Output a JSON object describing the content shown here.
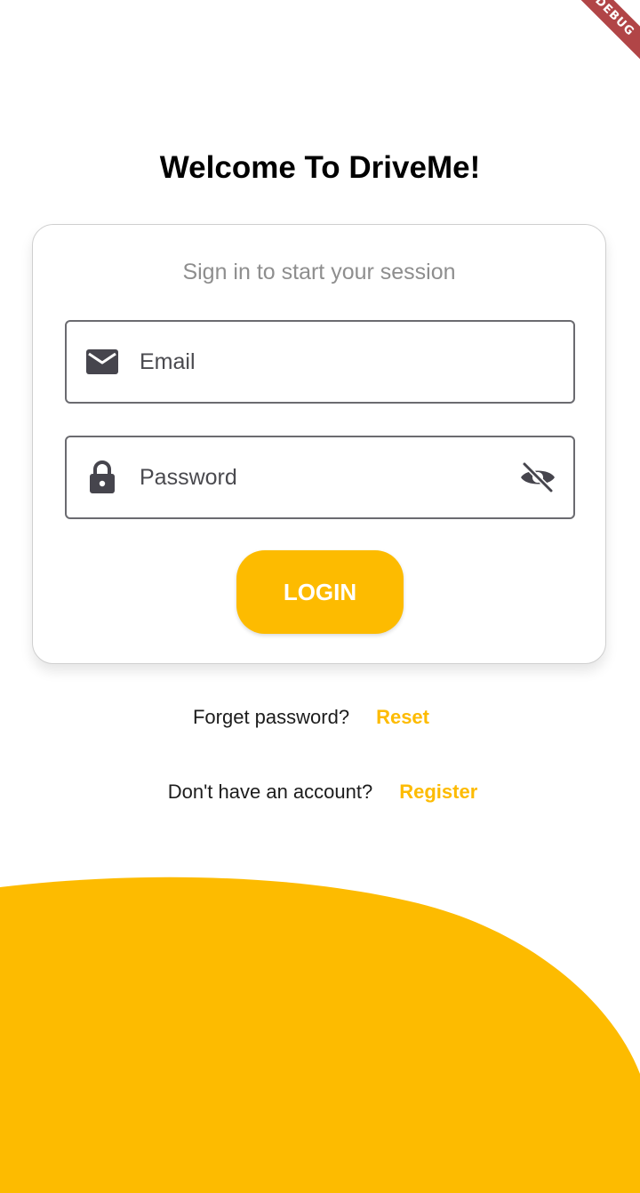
{
  "debug_banner": {
    "label": "DEBUG"
  },
  "header": {
    "title": "Welcome To DriveMe!"
  },
  "card": {
    "subtitle": "Sign in to start your session",
    "email": {
      "placeholder": "Email",
      "icon": "mail-icon"
    },
    "password": {
      "placeholder": "Password",
      "icon": "lock-icon",
      "toggle_icon": "visibility-off-icon"
    },
    "login_label": "LOGIN"
  },
  "forget": {
    "label": "Forget password?",
    "link": "Reset"
  },
  "register": {
    "label": "Don't have an account?",
    "link": "Register"
  },
  "colors": {
    "accent": "#fdbb00",
    "icon": "#46454d",
    "border": "#6b6b70",
    "subtitle": "#8e8e8e"
  }
}
